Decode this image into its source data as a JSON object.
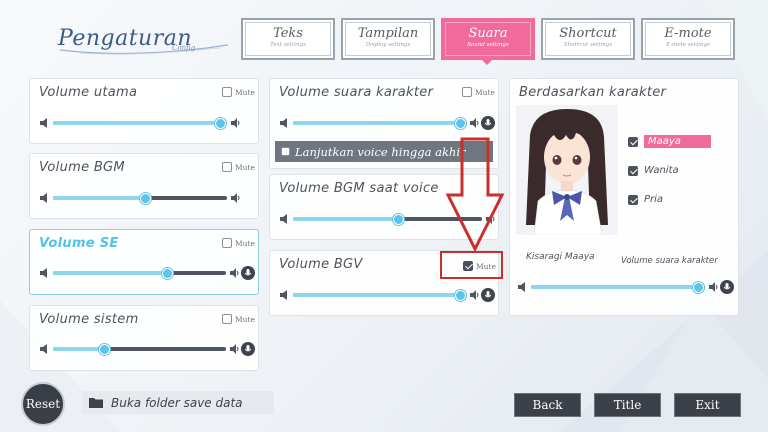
{
  "header": {
    "title": "Pengaturan",
    "subtitle": "Config"
  },
  "tabs": [
    {
      "label": "Teks",
      "sub": "Text settings",
      "active": false
    },
    {
      "label": "Tampilan",
      "sub": "Display settings",
      "active": false
    },
    {
      "label": "Suara",
      "sub": "Sound settings",
      "active": true
    },
    {
      "label": "Shortcut",
      "sub": "Shortcut settings",
      "active": false
    },
    {
      "label": "E-mote",
      "sub": "E-mote settings",
      "active": false
    }
  ],
  "mute_label": "Mute",
  "left_panels": [
    {
      "label": "Volume utama",
      "level": 0.96,
      "muted": false,
      "voice_icon": false,
      "highlighted": false
    },
    {
      "label": "Volume BGM",
      "level": 0.53,
      "muted": false,
      "voice_icon": false,
      "highlighted": false
    },
    {
      "label": "Volume SE",
      "level": 0.66,
      "muted": false,
      "voice_icon": true,
      "highlighted": true
    },
    {
      "label": "Volume sistem",
      "level": 0.3,
      "muted": false,
      "voice_icon": true,
      "highlighted": false
    }
  ],
  "middle": {
    "voice_character": {
      "label": "Volume suara karakter",
      "level": 0.97,
      "muted": false
    },
    "continue_voice": {
      "label": "Lanjutkan voice hingga akhir",
      "checked": false
    },
    "bgm_during_voice": {
      "label": "Volume BGM saat voice",
      "level": 0.56
    },
    "bgv": {
      "label": "Volume BGV",
      "level": 0.97,
      "muted": true
    }
  },
  "right": {
    "title": "Berdasarkan karakter",
    "filters": [
      {
        "label": "Maaya",
        "checked": true,
        "selected": true
      },
      {
        "label": "Wanita",
        "checked": true,
        "selected": false
      },
      {
        "label": "Pria",
        "checked": true,
        "selected": false
      }
    ],
    "character_name": "Kisaragi Maaya",
    "voice_label": "Volume suara karakter",
    "level": 0.96
  },
  "footer": {
    "reset_label": "Reset",
    "folder_label": "Buka folder save data",
    "back_label": "Back",
    "title_label": "Title",
    "exit_label": "Exit"
  },
  "colors": {
    "accent_pink": "#f06b9c",
    "slider_fill": "#8ed6ef",
    "knob": "#5cc4ea",
    "annotation_red": "#c8302c"
  }
}
